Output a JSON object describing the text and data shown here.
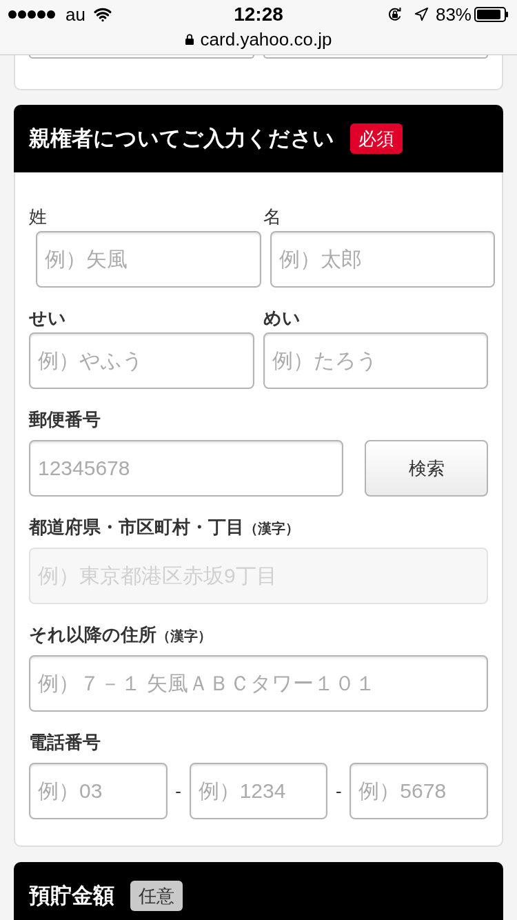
{
  "status_bar": {
    "carrier": "au",
    "time": "12:28",
    "battery": "83%",
    "url": "card.yahoo.co.jp"
  },
  "previous_card": {
    "inputs": [
      {
        "kind": "text_input"
      },
      {
        "kind": "text_input"
      }
    ]
  },
  "sections": [
    {
      "title": "親権者についてご入力ください",
      "badge": {
        "text": "必須",
        "kind": "required"
      },
      "rows": [
        {
          "kind": "name",
          "fields": [
            {
              "label": "姓",
              "placeholder": "例）矢風"
            },
            {
              "label": "名",
              "placeholder": "例）太郎"
            }
          ]
        },
        {
          "kind": "kana",
          "fields": [
            {
              "label": "せい",
              "placeholder": "例）やふう"
            },
            {
              "label": "めい",
              "placeholder": "例）たろう"
            }
          ]
        },
        {
          "kind": "postal",
          "label": "郵便番号",
          "placeholder": "12345678",
          "button": "検索"
        },
        {
          "kind": "address",
          "label": "都道府県・市区町村・丁目",
          "note": "（漢字）",
          "placeholder": "例）東京都港区赤坂9丁目",
          "disabled": true
        },
        {
          "kind": "address",
          "label": "それ以降の住所",
          "note": "（漢字）",
          "placeholder": "例）７－１ 矢風ＡＢＣタワー１０１",
          "disabled": false
        },
        {
          "kind": "phone",
          "label": "電話番号",
          "fields": [
            {
              "placeholder": "例）03"
            },
            {
              "placeholder": "例）1234"
            },
            {
              "placeholder": "例）5678"
            }
          ],
          "separators": [
            "-",
            "-"
          ]
        }
      ]
    },
    {
      "title": "預貯金額",
      "badge": {
        "text": "任意",
        "kind": "optional"
      }
    }
  ]
}
